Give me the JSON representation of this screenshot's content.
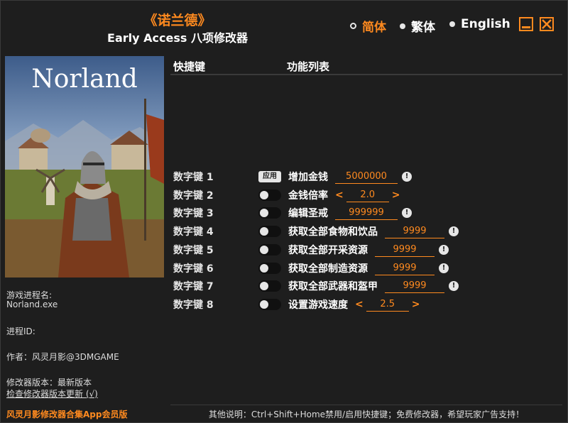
{
  "header": {
    "title": "《诺兰德》",
    "subtitle": "Early Access 八项修改器"
  },
  "languages": [
    {
      "label": "简体",
      "active": true
    },
    {
      "label": "繁体",
      "active": false
    },
    {
      "label": "English",
      "active": false
    }
  ],
  "cover": {
    "title": "Norland"
  },
  "info": {
    "process_name_label": "游戏进程名:",
    "process_name_value": "Norland.exe",
    "pid_label": "进程ID:",
    "author": "作者：风灵月影@3DMGAME",
    "version": "修改器版本：最新版本",
    "check_update": "检查修改器版本更新 (√)",
    "promo": "风灵月影修改器合集App会员版"
  },
  "columns": {
    "hotkey": "快捷键",
    "function": "功能列表"
  },
  "apply_label": "应用",
  "cheats": [
    {
      "hotkey": "数字键 1",
      "name": "增加金钱",
      "value": "5000000",
      "control": "apply"
    },
    {
      "hotkey": "数字键 2",
      "name": "金钱倍率",
      "value": "2.0",
      "control": "toggle",
      "arrows": [
        "<",
        ">"
      ]
    },
    {
      "hotkey": "数字键 3",
      "name": "编辑圣戒",
      "value": "999999",
      "control": "toggle"
    },
    {
      "hotkey": "数字键 4",
      "name": "获取全部食物和饮品",
      "value": "9999",
      "control": "toggle"
    },
    {
      "hotkey": "数字键 5",
      "name": "获取全部开采资源",
      "value": "9999",
      "control": "toggle"
    },
    {
      "hotkey": "数字键 6",
      "name": "获取全部制造资源",
      "value": "9999",
      "control": "toggle"
    },
    {
      "hotkey": "数字键 7",
      "name": "获取全部武器和盔甲",
      "value": "9999",
      "control": "toggle"
    },
    {
      "hotkey": "数字键 8",
      "name": "设置游戏速度",
      "value": "2.5",
      "control": "toggle",
      "arrows": [
        "<",
        ">"
      ]
    }
  ],
  "footer": "其他说明：Ctrl+Shift+Home禁用/启用快捷键；免费修改器，希望玩家广告支持！",
  "colors": {
    "accent": "#ff8a1f",
    "background": "#1e1e1e"
  },
  "icons": {
    "warning": "!"
  }
}
